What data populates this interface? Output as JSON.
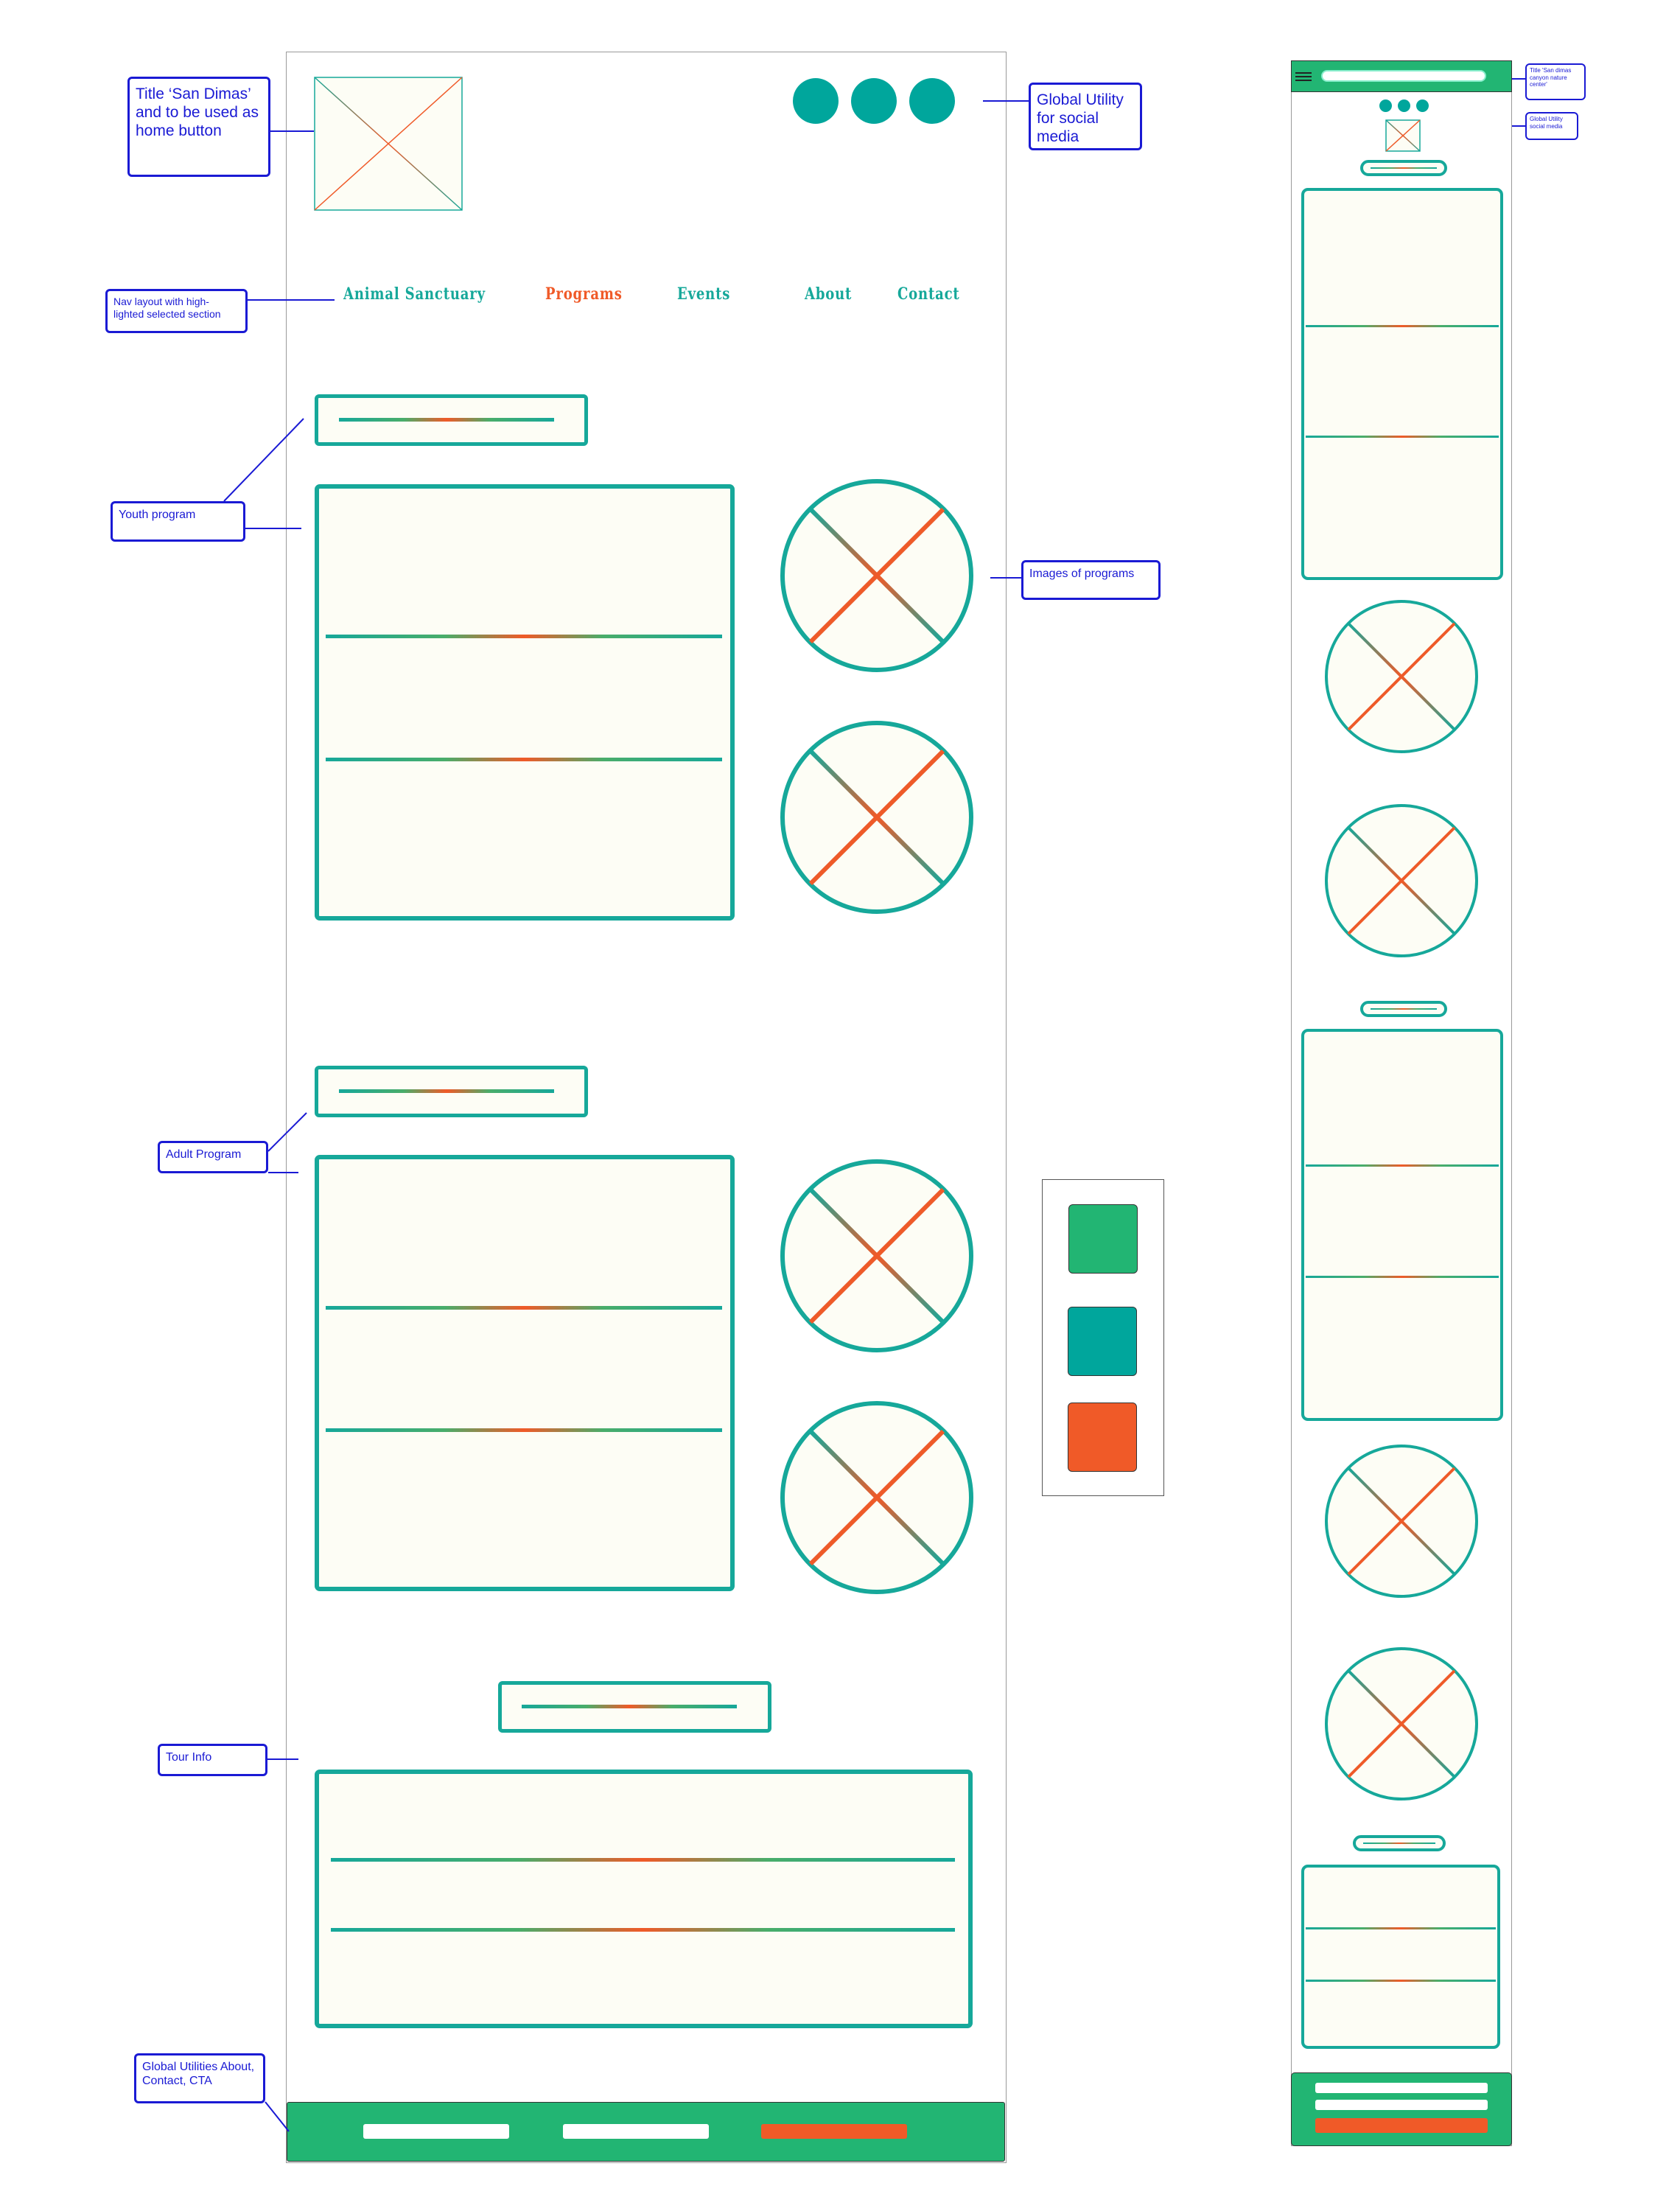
{
  "callouts": {
    "title_home": "Title ‘San Dimas’ and to be used as home button",
    "global_utility_social": "Global Utility for social media",
    "nav_layout": "Nav layout with high-lighted selected section",
    "youth_program": "Youth program",
    "images_of_programs": "Images of programs",
    "adult_program": "Adult Program",
    "tour_info": "Tour Info",
    "global_utilities_footer": "Global Utilities About, Contact, CTA",
    "mobile_title": "Title 'San dimas canyon nature center'",
    "mobile_social": "Global Utility social media"
  },
  "nav": {
    "items": [
      {
        "label": "Animal Sanctuary",
        "selected": false
      },
      {
        "label": "Programs",
        "selected": true
      },
      {
        "label": "Events",
        "selected": false
      },
      {
        "label": "About",
        "selected": false
      },
      {
        "label": "Contact",
        "selected": false
      }
    ]
  },
  "colors": {
    "teal": "#00a69c",
    "green": "#22b573",
    "orange": "#f05a28",
    "border_teal": "#16a89a",
    "annotation_blue": "#1a1ad4",
    "panel_fill": "#fdfdf5"
  },
  "palette": [
    "#22b573",
    "#00a69c",
    "#f05a28"
  ],
  "icons": {
    "image_placeholder": "x-placeholder-icon",
    "social": "circle-icon",
    "menu": "hamburger-icon"
  }
}
